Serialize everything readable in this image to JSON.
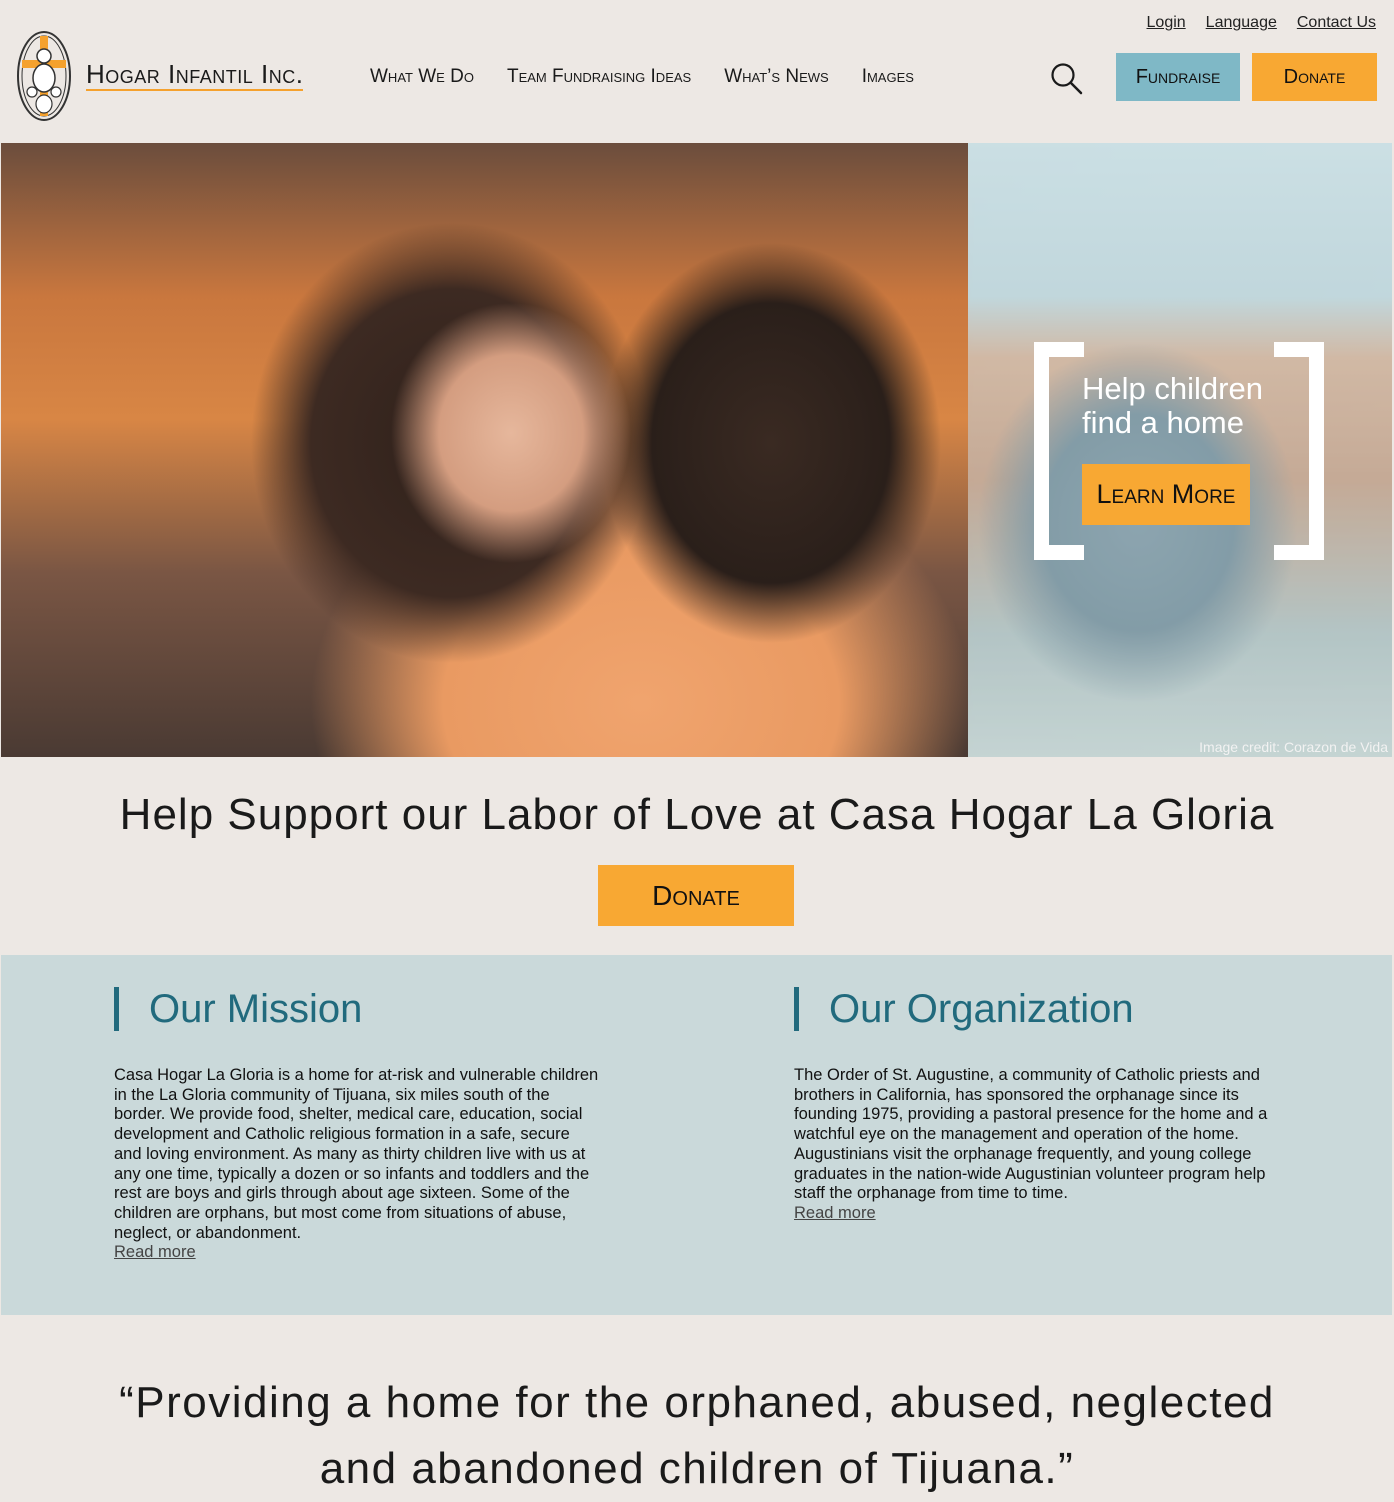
{
  "utility_nav": {
    "login": "Login",
    "language": "Language",
    "contact": "Contact Us"
  },
  "logo": {
    "text": "Hogar Infantil Inc.",
    "icon": "logo-emblem"
  },
  "nav": [
    "What We Do",
    "Team Fundraising Ideas",
    "What’s News",
    "Images"
  ],
  "header_buttons": {
    "fundraise": "Fundraise",
    "donate": "Donate"
  },
  "hero": {
    "heading_line1": "Help children",
    "heading_line2": "find a home",
    "cta": "Learn More",
    "credit": "Image credit: Corazon de Vida"
  },
  "support": {
    "title": "Help Support our Labor of Love at Casa Hogar La Gloria",
    "donate": "Donate"
  },
  "mission": {
    "title": "Our Mission",
    "body": "Casa Hogar La Gloria is a home for at-risk and vulnerable children in the La Gloria community of Tijuana, six miles south of the border.  We provide food, shelter, medical care, education, social development and Catholic religious formation in a safe, secure and loving environment.  As many as thirty children live with us at any one time, typically a dozen or so infants and toddlers and the rest are boys and girls through about age sixteen.  Some of the children are orphans, but most come from situations of abuse, neglect, or abandonment.",
    "read_more": "Read more"
  },
  "organization": {
    "title": "Our Organization",
    "body": "The Order of St. Augustine, a community of Catholic priests and brothers in California, has sponsored the orphanage since its founding 1975, providing a pastoral presence for the home and a watchful eye on the management and operation of the home.  Augustinians visit the orphanage frequently, and young college graduates in the nation-wide Augustinian volunteer program help staff the orphanage from time to time.",
    "read_more": "Read more"
  },
  "quote": {
    "line1": "“Providing a home for the orphaned, abused, neglected",
    "line2": "and abandoned children of Tijuana.”"
  },
  "colors": {
    "accent_orange": "#f8a833",
    "accent_blue": "#7fb8c6",
    "heading_teal": "#216a7d",
    "band": "#cad9da",
    "page_bg": "#ede8e4"
  }
}
